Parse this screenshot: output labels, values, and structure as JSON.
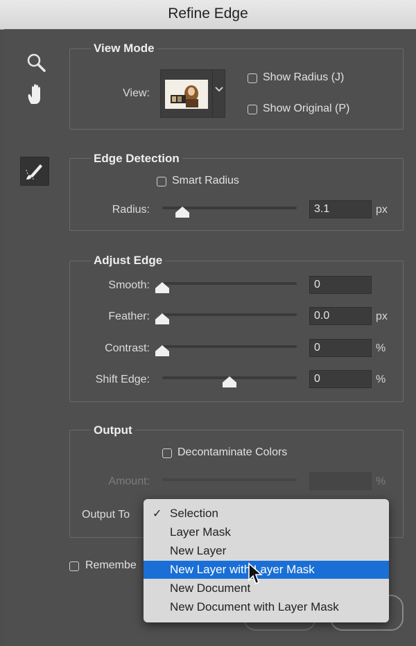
{
  "window": {
    "title": "Refine Edge"
  },
  "tools": {
    "zoom_icon": "magnifier-icon",
    "hand_icon": "hand-icon",
    "brush_icon": "refine-radius-brush-icon"
  },
  "view_mode": {
    "title": "View Mode",
    "view_label": "View:",
    "show_radius": {
      "label": "Show Radius (J)",
      "checked": false
    },
    "show_original": {
      "label": "Show Original (P)",
      "checked": false
    }
  },
  "edge_detection": {
    "title": "Edge Detection",
    "smart_radius": {
      "label": "Smart Radius",
      "checked": false
    },
    "radius": {
      "label": "Radius:",
      "value": "3.1",
      "unit": "px",
      "slider_fraction": 0.15
    }
  },
  "adjust_edge": {
    "title": "Adjust Edge",
    "smooth": {
      "label": "Smooth:",
      "value": "0",
      "unit": "",
      "slider_fraction": 0.0
    },
    "feather": {
      "label": "Feather:",
      "value": "0.0",
      "unit": "px",
      "slider_fraction": 0.0
    },
    "contrast": {
      "label": "Contrast:",
      "value": "0",
      "unit": "%",
      "slider_fraction": 0.0
    },
    "shift_edge": {
      "label": "Shift Edge:",
      "value": "0",
      "unit": "%",
      "slider_fraction": 0.5
    }
  },
  "output": {
    "title": "Output",
    "decontaminate": {
      "label": "Decontaminate Colors",
      "checked": false
    },
    "amount": {
      "label": "Amount:",
      "unit": "%",
      "enabled": false
    },
    "output_to_label": "Output To",
    "remember_label": "Remembe"
  },
  "output_menu": {
    "selected": "Selection",
    "highlighted": "New Layer with Layer Mask",
    "items": [
      "Selection",
      "Layer Mask",
      "New Layer",
      "New Layer with Layer Mask",
      "New Document",
      "New Document with Layer Mask"
    ]
  },
  "colors": {
    "highlight": "#1a6fd6",
    "panel": "#4f4f4f"
  }
}
